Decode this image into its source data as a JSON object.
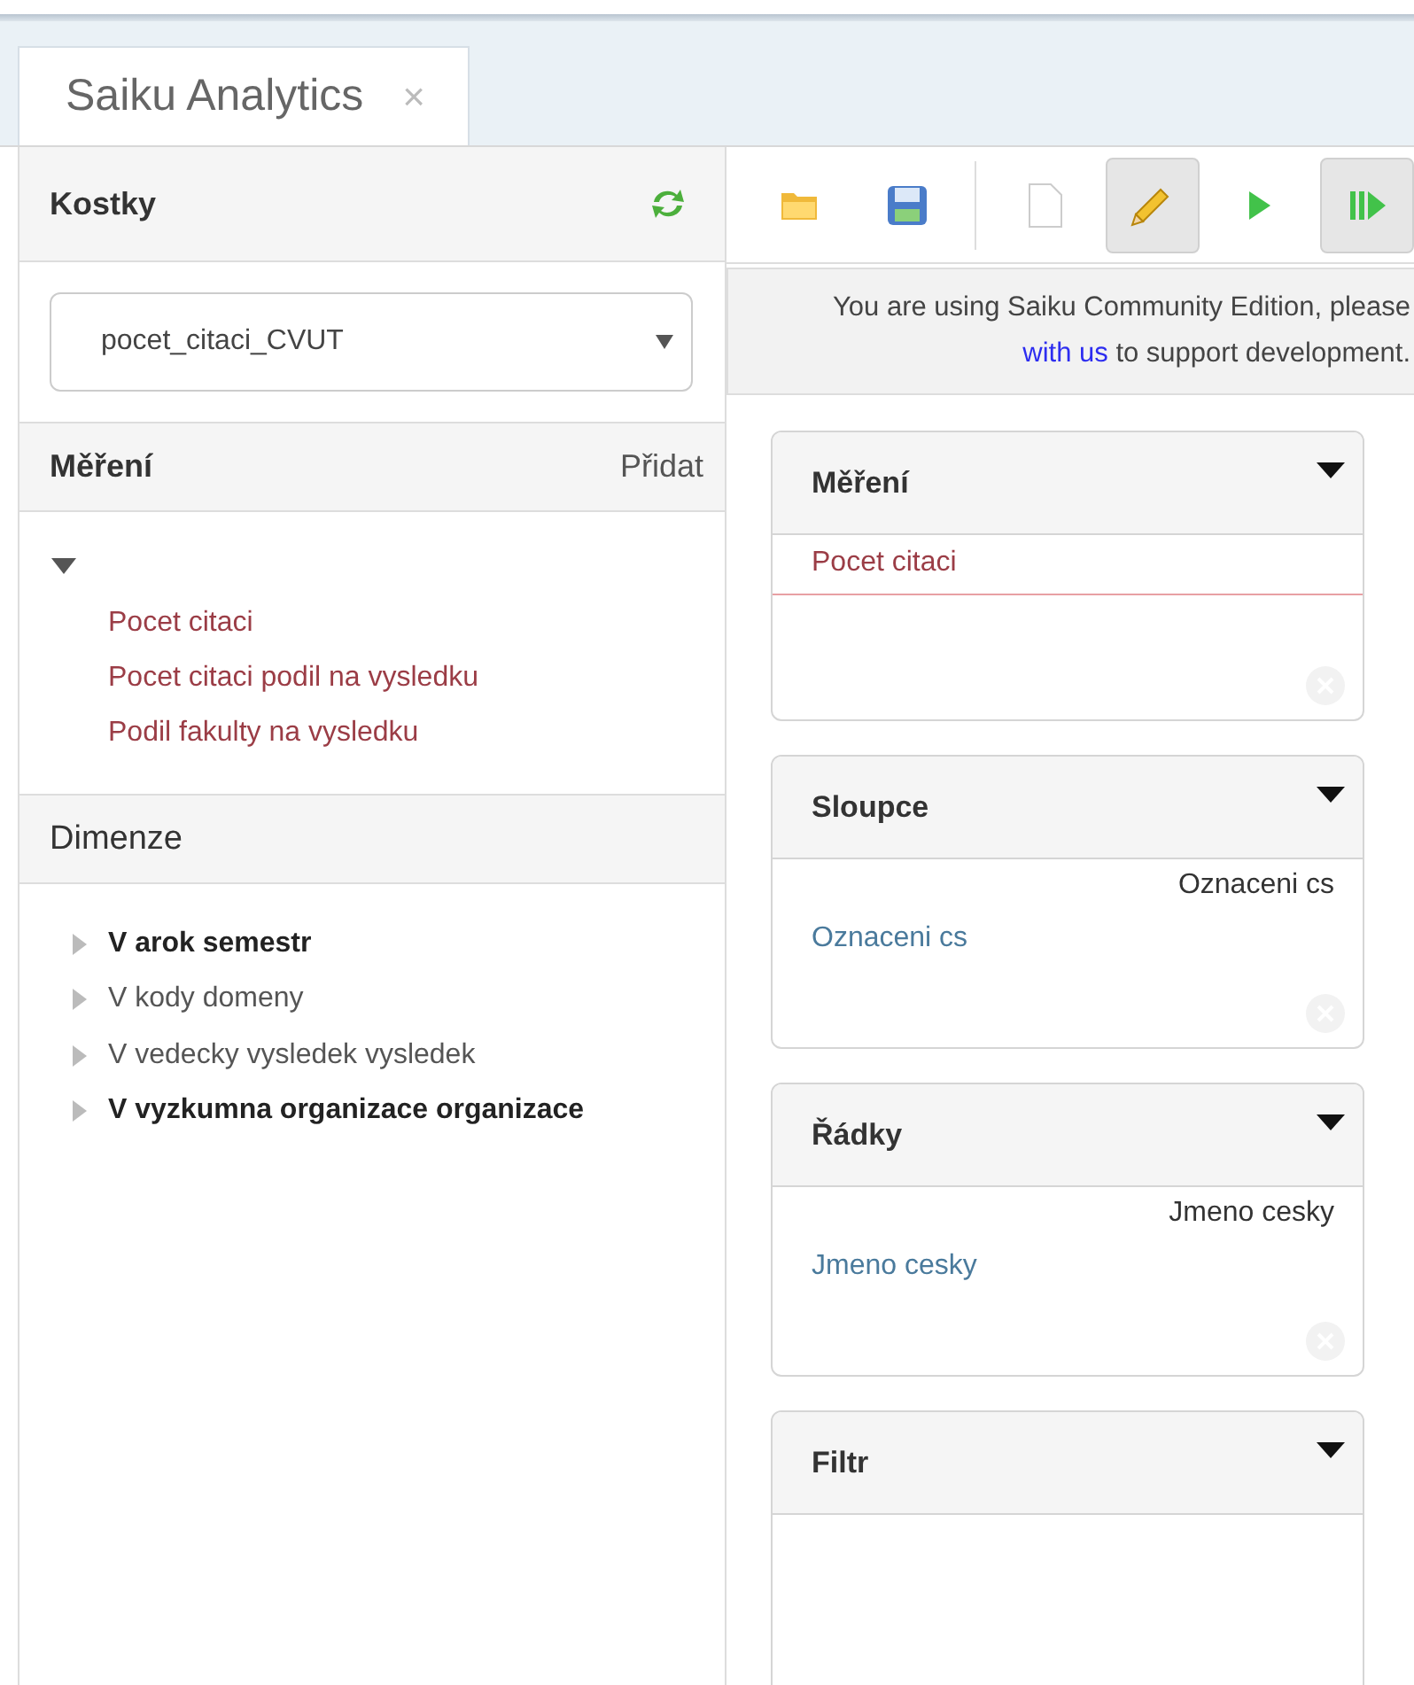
{
  "tab": {
    "title": "Saiku Analytics",
    "close": "×"
  },
  "cubes": {
    "title": "Kostky",
    "selected_cube": "pocet_citaci_CVUT"
  },
  "measures": {
    "title": "Měření",
    "add": "Přidat",
    "expanded": true,
    "items": [
      "Pocet citaci",
      "Pocet citaci podil na vysledku",
      "Podil fakulty na vysledku"
    ]
  },
  "dimensions": {
    "title": "Dimenze",
    "items": [
      {
        "label": "V arok semestr",
        "active": true
      },
      {
        "label": "V kody domeny",
        "active": false
      },
      {
        "label": "V vedecky vysledek vysledek",
        "active": false
      },
      {
        "label": "V vyzkumna organizace organizace",
        "active": true
      }
    ]
  },
  "toolbar": [
    {
      "kind": "open",
      "active": false
    },
    {
      "kind": "save",
      "active": false
    },
    {
      "kind": "separator"
    },
    {
      "kind": "new",
      "active": false
    },
    {
      "kind": "edit",
      "active": true
    },
    {
      "kind": "run",
      "active": false
    },
    {
      "kind": "auto-run",
      "active": true
    }
  ],
  "notice": {
    "line1": "You are using Saiku Community Edition, please",
    "link": "with us",
    "line2": " to support development."
  },
  "drop_zones": [
    {
      "title": "Měření",
      "kind": "measures",
      "items": [
        "Pocet citaci"
      ],
      "clearable": true
    },
    {
      "title": "Sloupce",
      "kind": "axis",
      "hierarchy": "Oznaceni cs",
      "items": [
        "Oznaceni cs"
      ],
      "clearable": true
    },
    {
      "title": "Řádky",
      "kind": "axis",
      "hierarchy": "Jmeno cesky",
      "items": [
        "Jmeno cesky"
      ],
      "clearable": true
    },
    {
      "title": "Filtr",
      "kind": "axis",
      "clearable": false
    }
  ]
}
